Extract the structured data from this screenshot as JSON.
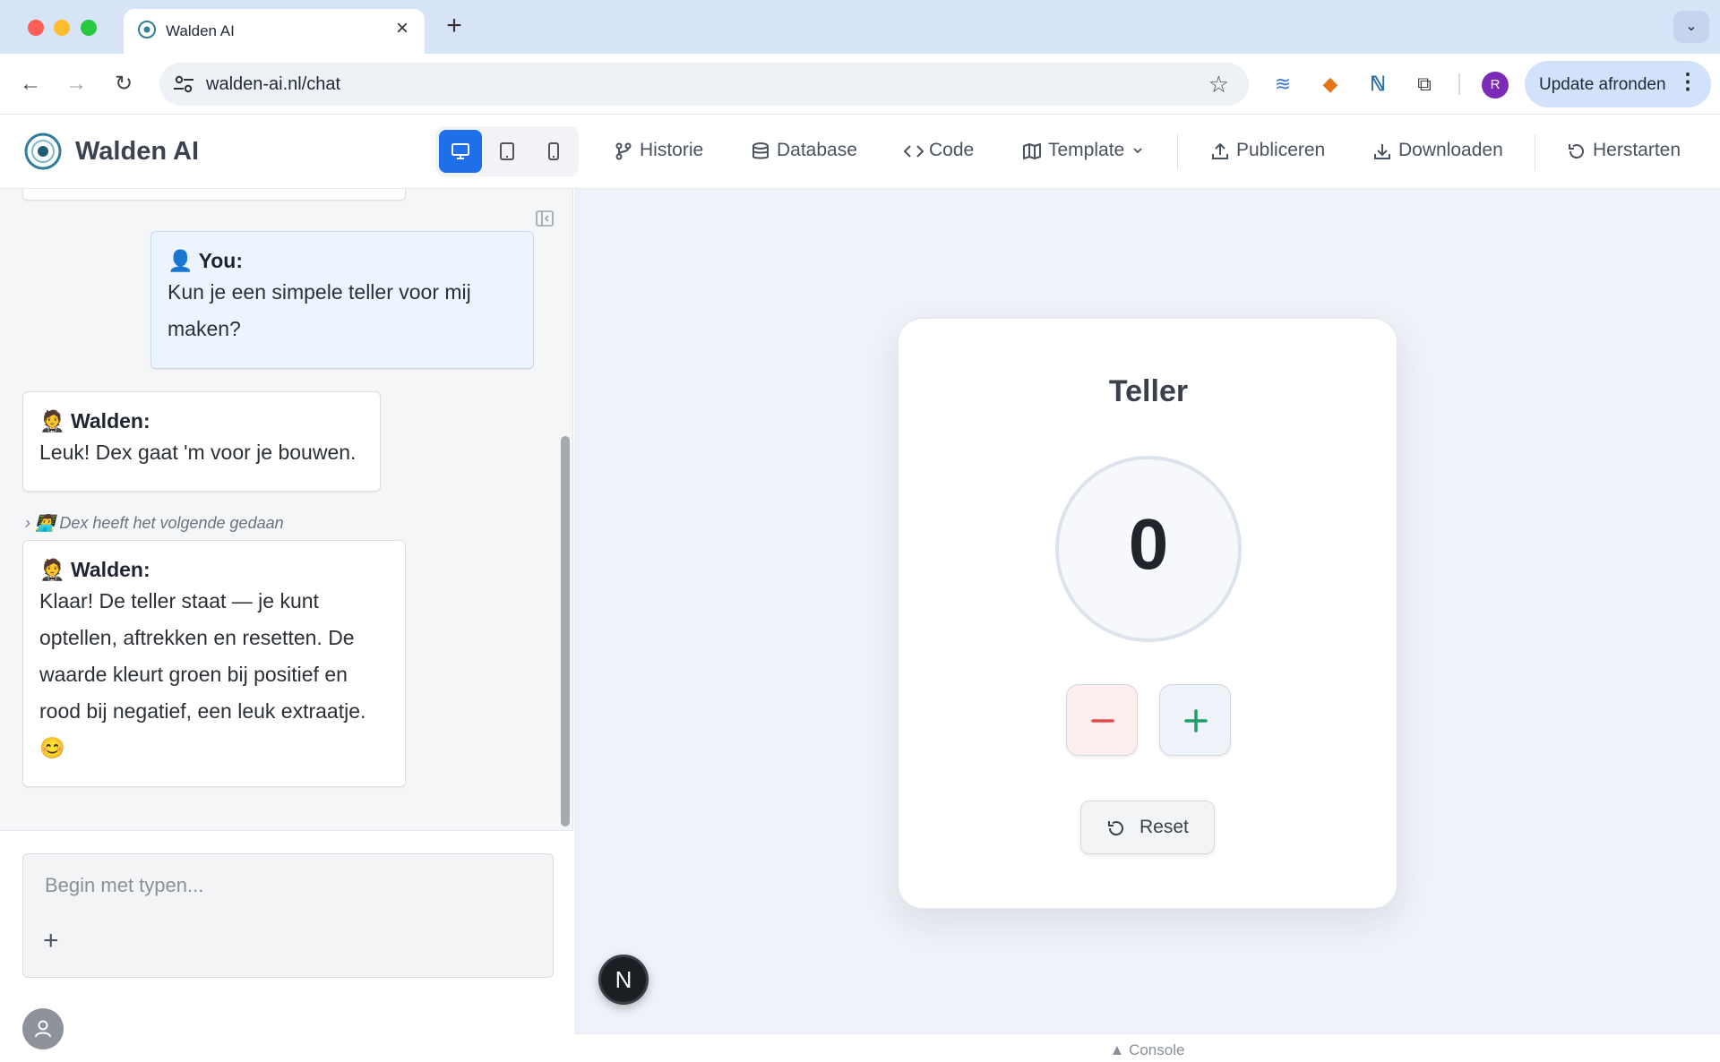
{
  "browser": {
    "tab_title": "Walden AI",
    "url": "walden-ai.nl/chat",
    "profile_initial": "R",
    "update_label": "Update afronden"
  },
  "app": {
    "brand": "Walden AI",
    "nav": {
      "history": "Historie",
      "database": "Database",
      "code": "Code",
      "template": "Template",
      "publish": "Publiceren",
      "download": "Downloaden",
      "restart": "Herstarten"
    }
  },
  "chat": {
    "messages": [
      {
        "author": "👤 You:",
        "text": "Kun je een simpele teller voor mij maken?"
      },
      {
        "author": "🤵 Walden:",
        "text": "Leuk! Dex gaat 'm voor je bouwen."
      },
      {
        "author": "🤵 Walden:",
        "text": "Klaar! De teller staat — je kunt optellen, aftrekken en resetten. De waarde kleurt groen bij positief en rood bij negatief, een leuk extraatje. 😊"
      }
    ],
    "dex_note": "👨‍💻 Dex heeft het volgende gedaan",
    "composer_placeholder": "Begin met typen..."
  },
  "preview": {
    "card_title": "Teller",
    "counter_value": "0",
    "reset_label": "Reset",
    "next_badge": "N",
    "console_label": "▲ Console"
  },
  "colors": {
    "accent": "#1f6feb",
    "minus": "#e5484d",
    "plus": "#1f9d6b"
  }
}
